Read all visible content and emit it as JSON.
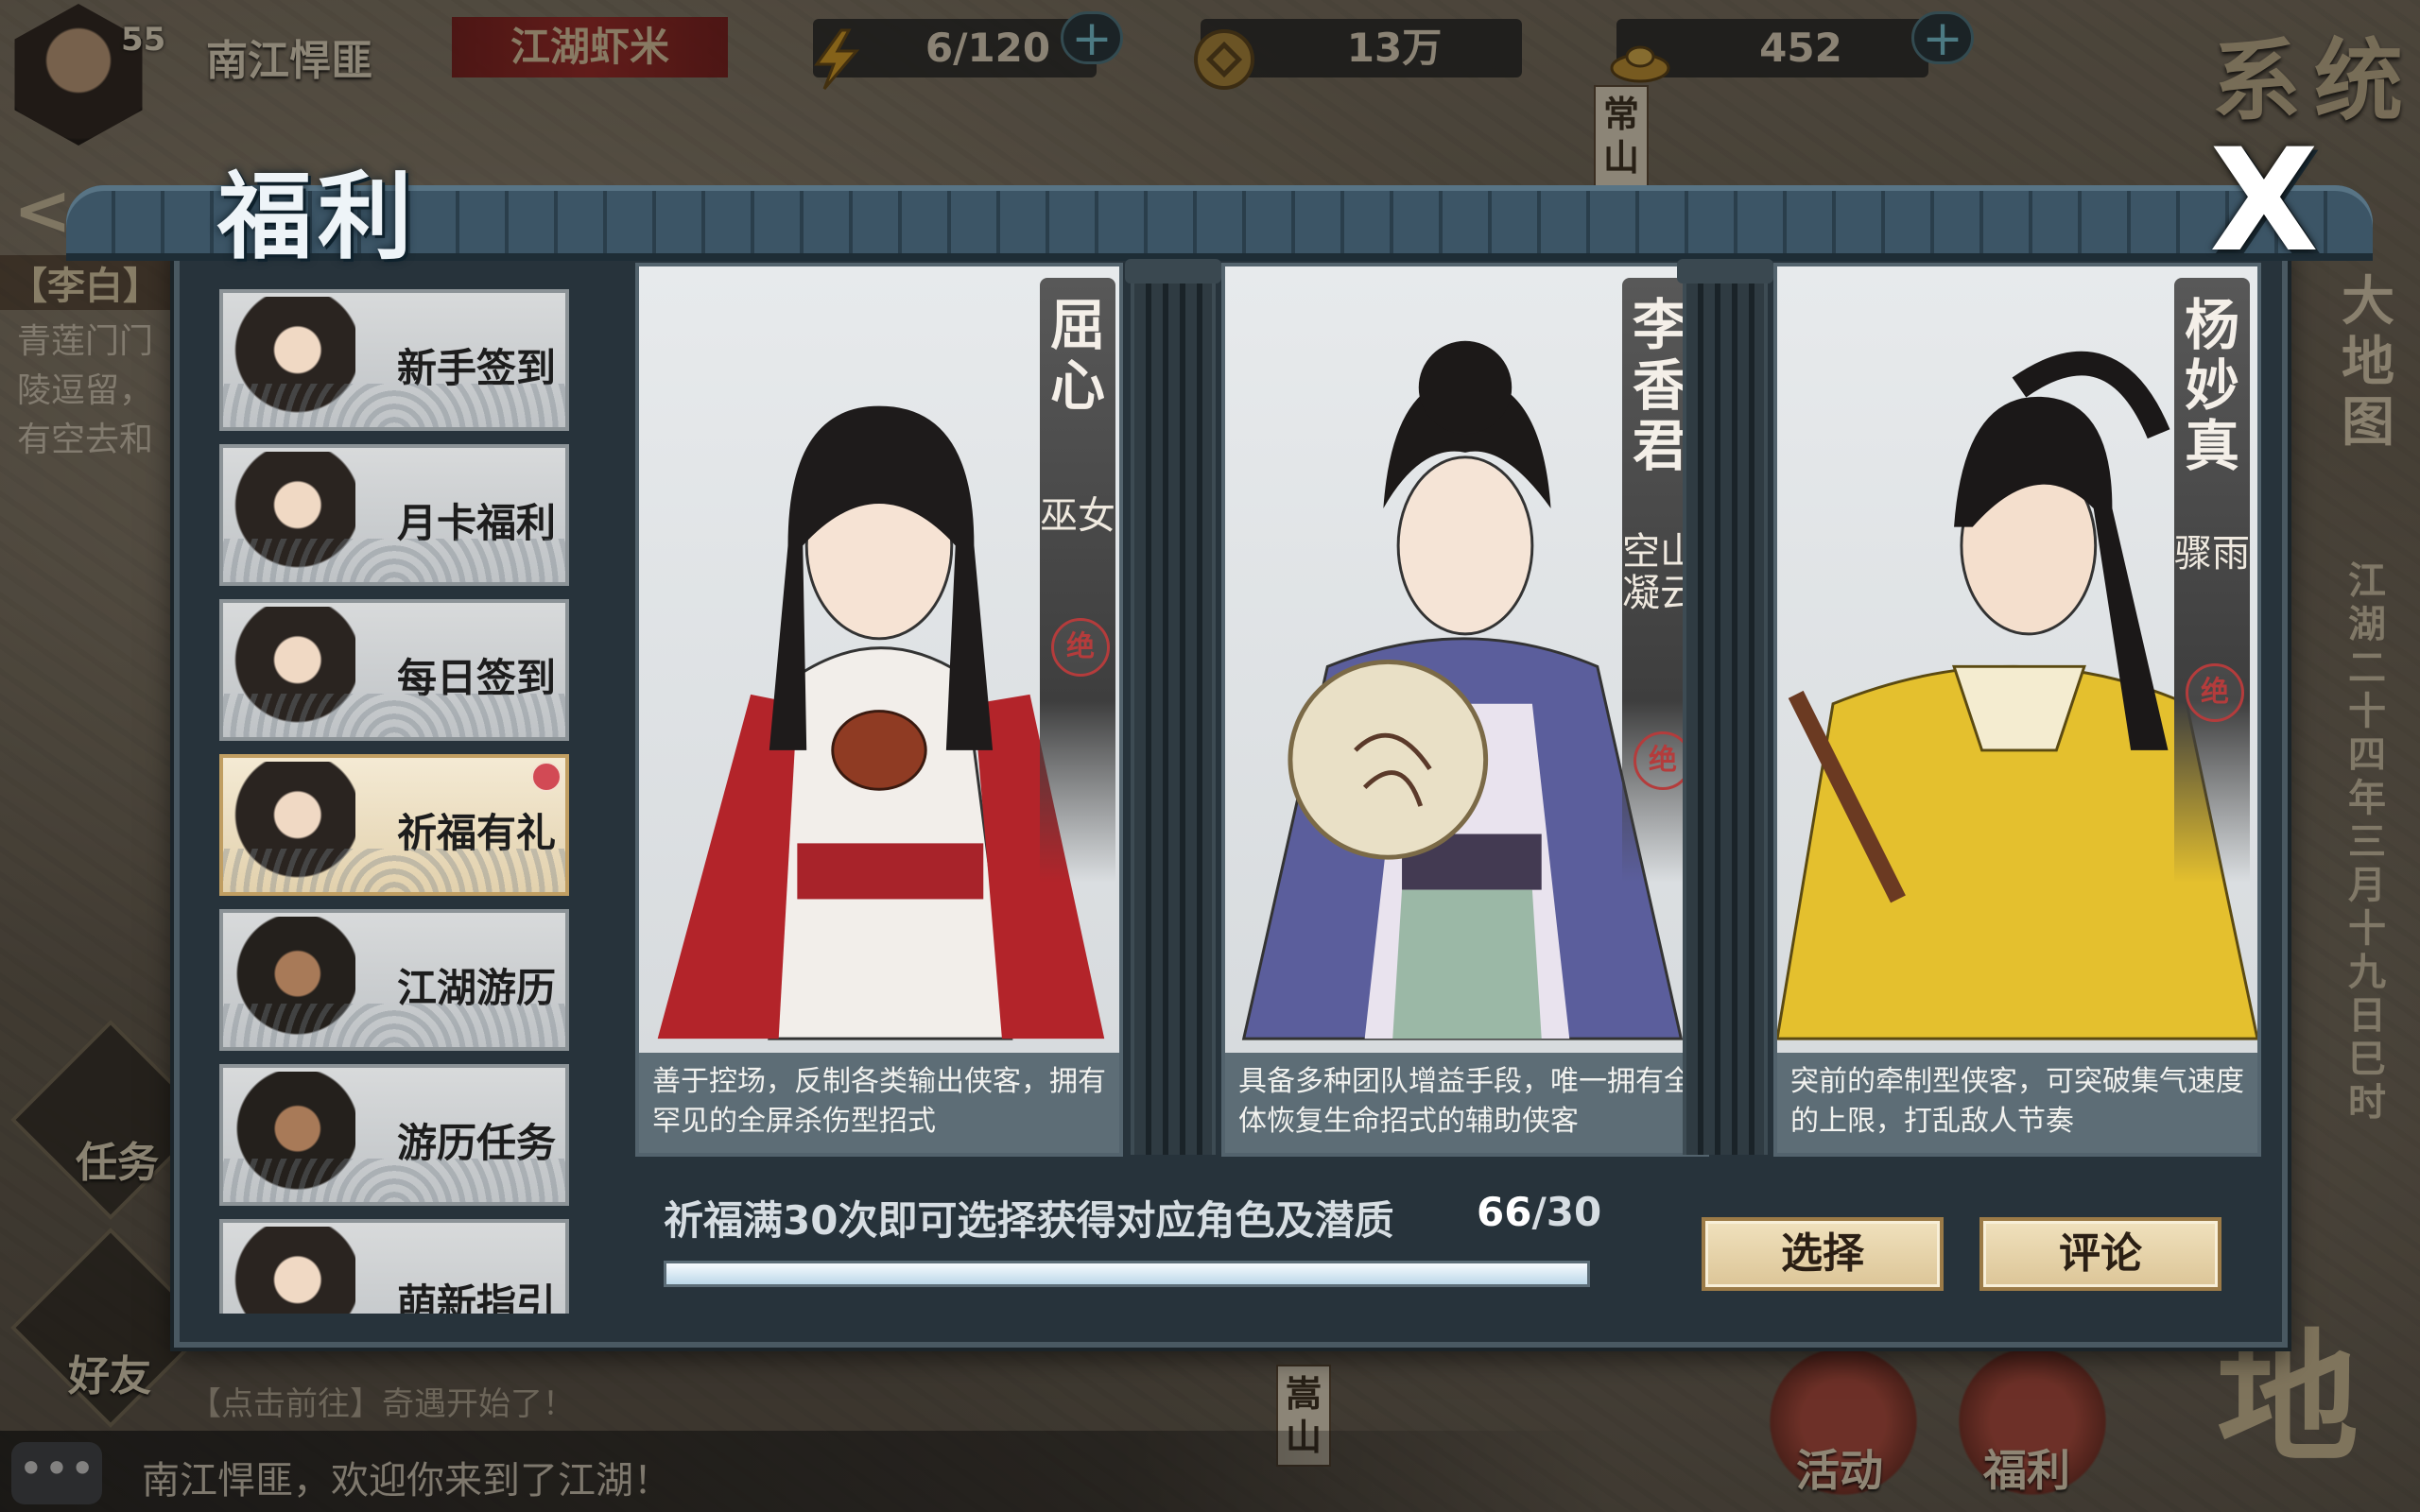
{
  "top_bar": {
    "level": "55",
    "player_name": "南江悍匪",
    "rank": "江湖虾米",
    "stamina": "6/120",
    "coins": "13万",
    "ingots": "452",
    "system_label": "系统"
  },
  "left_panel": {
    "quest_name": "【李白】",
    "quest_desc": "青莲门门\n陵逗留，\n有空去和",
    "task_label": "任务",
    "friend_label": "好友"
  },
  "right_panel": {
    "bigmap_label": "大地图",
    "date": "江湖二十四年三月十九日巳时",
    "land_label": "地"
  },
  "bottom": {
    "notice": "【点击前往】奇遇开始了！",
    "chat_message": "南江悍匪，欢迎你来到了江湖！",
    "activity_label": "活动",
    "welfare_label": "福利",
    "map_signs": [
      "常山",
      "嵩山"
    ]
  },
  "welfare": {
    "title": "福利",
    "close_label": "X",
    "tabs": [
      {
        "label": "新手签到",
        "active": false
      },
      {
        "label": "月卡福利",
        "active": false
      },
      {
        "label": "每日签到",
        "active": false
      },
      {
        "label": "祈福有礼",
        "active": true
      },
      {
        "label": "江湖游历",
        "active": false
      },
      {
        "label": "游历任务",
        "active": false
      },
      {
        "label": "萌新指引",
        "active": false
      }
    ],
    "characters": [
      {
        "name": "屈心",
        "trait": "巫女",
        "seal": "绝",
        "description": "善于控场，反制各类输出侠客，拥有罕见的全屏杀伤型招式",
        "costume_color": "#b3242a"
      },
      {
        "name": "李香君",
        "trait": "空山凝云",
        "seal": "绝",
        "description": "具备多种团队增益手段，唯一拥有全体恢复生命招式的辅助侠客",
        "costume_color": "#5b5e9c"
      },
      {
        "name": "杨妙真",
        "trait": "骤雨",
        "seal": "绝",
        "description": "突前的牵制型侠客，可突破集气速度的上限，打乱敌人节奏",
        "costume_color": "#e4c02e"
      }
    ],
    "progress_text": "祈福满30次即可选择获得对应角色及潜质",
    "progress_done": "66",
    "progress_total": "/30",
    "progress_fraction": 1.0,
    "select_label": "选择",
    "comment_label": "评论"
  }
}
